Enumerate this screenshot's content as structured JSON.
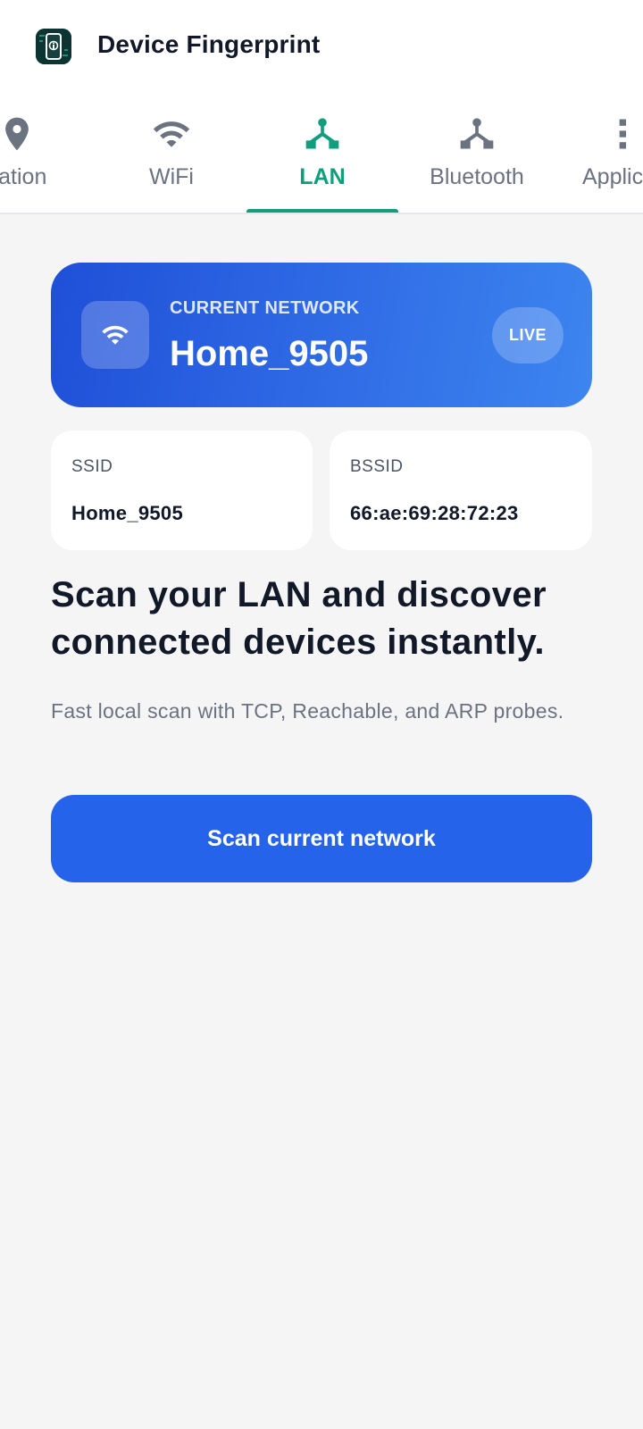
{
  "app": {
    "title": "Device Fingerprint",
    "icon": "phone-fingerprint-icon"
  },
  "tabs": [
    {
      "label": "cation",
      "icon": "location-pin-icon",
      "active": false
    },
    {
      "label": "WiFi",
      "icon": "wifi-icon",
      "active": false
    },
    {
      "label": "LAN",
      "icon": "lan-network-icon",
      "active": true
    },
    {
      "label": "Bluetooth",
      "icon": "bluetooth-network-icon",
      "active": false
    },
    {
      "label": "Applic",
      "icon": "apps-icon",
      "active": false
    }
  ],
  "hero": {
    "caption": "CURRENT NETWORK",
    "network_name": "Home_9505",
    "badge": "LIVE",
    "icon": "wifi-icon"
  },
  "info": {
    "ssid": {
      "label": "SSID",
      "value": "Home_9505"
    },
    "bssid": {
      "label": "BSSID",
      "value": "66:ae:69:28:72:23"
    }
  },
  "headline": "Scan your LAN and discover connected devices instantly.",
  "subtext": "Fast local scan with TCP, Reachable, and ARP probes.",
  "scan_button": "Scan current network",
  "colors": {
    "accent_green": "#119e7c",
    "primary_blue": "#2563eb",
    "gradient_start": "#1f4fd8",
    "gradient_end": "#3d85f0",
    "inactive_gray": "#6b7280",
    "background": "#f5f5f6"
  }
}
